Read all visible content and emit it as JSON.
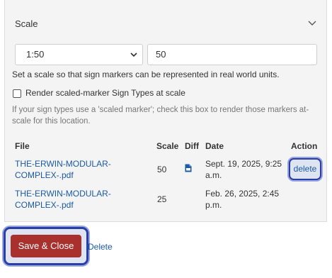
{
  "panel": {
    "title": "Scale",
    "scale_select": {
      "value": "1:50"
    },
    "scale_input": {
      "value": "50"
    },
    "help_text": "Set a scale so that sign markers can be represented in real world units.",
    "checkbox": {
      "label": "Render scaled-marker Sign Types at scale",
      "checked": false
    },
    "checkbox_help": "If your sign types use a 'scaled marker'; check this box to render those markers at-scale for this location."
  },
  "table": {
    "headers": {
      "file": "File",
      "scale": "Scale",
      "diff": "Diff",
      "date": "Date",
      "action": "Action"
    },
    "rows": [
      {
        "file_line1": "THE-ERWIN-MODULAR-",
        "file_line2": "COMPLEX-.pdf",
        "scale": "50",
        "diff_icon": "pdf-file-icon",
        "date_line1": "Sept. 19, 2025, 9:25",
        "date_line2": "a.m.",
        "action": "delete"
      },
      {
        "file_line1": "THE-ERWIN-MODULAR-",
        "file_line2": "COMPLEX-.pdf",
        "scale": "25",
        "date_line1": "Feb. 26, 2025, 2:45",
        "date_line2": "p.m."
      }
    ]
  },
  "footer": {
    "save_label": "Save & Close",
    "delete_label": "Delete"
  },
  "colors": {
    "save_button": "#a8312e",
    "link": "#1a5aa6",
    "focus_ring": "#2a3ea8",
    "panel_bg": "#f4f4f4"
  }
}
